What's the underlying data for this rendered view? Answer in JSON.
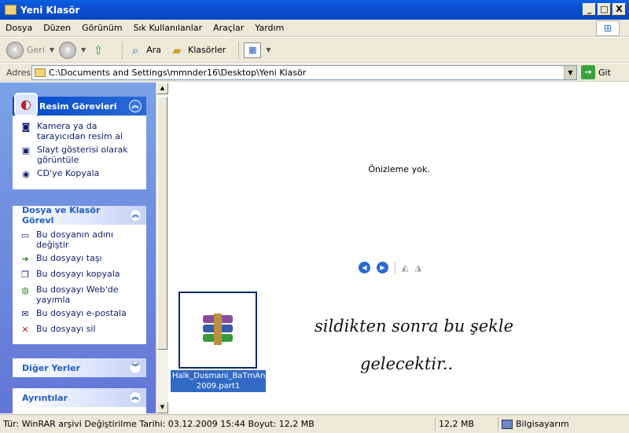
{
  "window": {
    "title": "Yeni Klasör",
    "controls": {
      "minimize": "_",
      "maximize": "□",
      "close": "X"
    }
  },
  "menu": [
    "Dosya",
    "Düzen",
    "Görünüm",
    "Sık Kullanılanlar",
    "Araçlar",
    "Yardım"
  ],
  "toolbar": {
    "back_label": "Geri",
    "search_label": "Ara",
    "folders_label": "Klasörler"
  },
  "address": {
    "label": "Adres",
    "value": "C:\\Documents and Settings\\mmnder16\\Desktop\\Yeni Klasör",
    "go_label": "Git"
  },
  "left_panels": {
    "picture_tasks": {
      "title": "Resim Görevleri",
      "items": [
        {
          "label": "Kamera ya da tarayıcıdan resim al",
          "icon": "camera-icon"
        },
        {
          "label": "Slayt gösterisi olarak görüntüle",
          "icon": "slideshow-icon"
        },
        {
          "label": "CD'ye Kopyala",
          "icon": "cd-icon"
        }
      ]
    },
    "file_tasks": {
      "title": "Dosya ve Klasör Görevl",
      "items": [
        {
          "label": "Bu dosyanın adını değiştir",
          "icon": "rename-icon"
        },
        {
          "label": "Bu dosyayı taşı",
          "icon": "move-icon"
        },
        {
          "label": "Bu dosyayı kopyala",
          "icon": "copy-icon"
        },
        {
          "label": "Bu dosyayı Web'de yayımla",
          "icon": "publish-web-icon"
        },
        {
          "label": "Bu dosyayı e-postala",
          "icon": "email-icon"
        },
        {
          "label": "Bu dosyayı sil",
          "icon": "delete-icon"
        }
      ]
    },
    "other_places": {
      "title": "Diğer Yerler"
    },
    "details": {
      "title": "Ayrıntılar"
    }
  },
  "preview": {
    "no_preview": "Önizleme yok."
  },
  "file": {
    "name_line1": "Halk_Dusmani_BaTmAn_",
    "name_line2": "2009.part1",
    "icon": "winrar-archive-icon"
  },
  "annotation": {
    "line1": "sildikten sonra bu şekle",
    "line2": "gelecektir.."
  },
  "status": {
    "info": "Tür: WinRAR arşivi Değiştirilme Tarihi: 03.12.2009 15:44 Boyut: 12,2 MB",
    "size": "12,2 MB",
    "location": "Bilgisayarım"
  }
}
